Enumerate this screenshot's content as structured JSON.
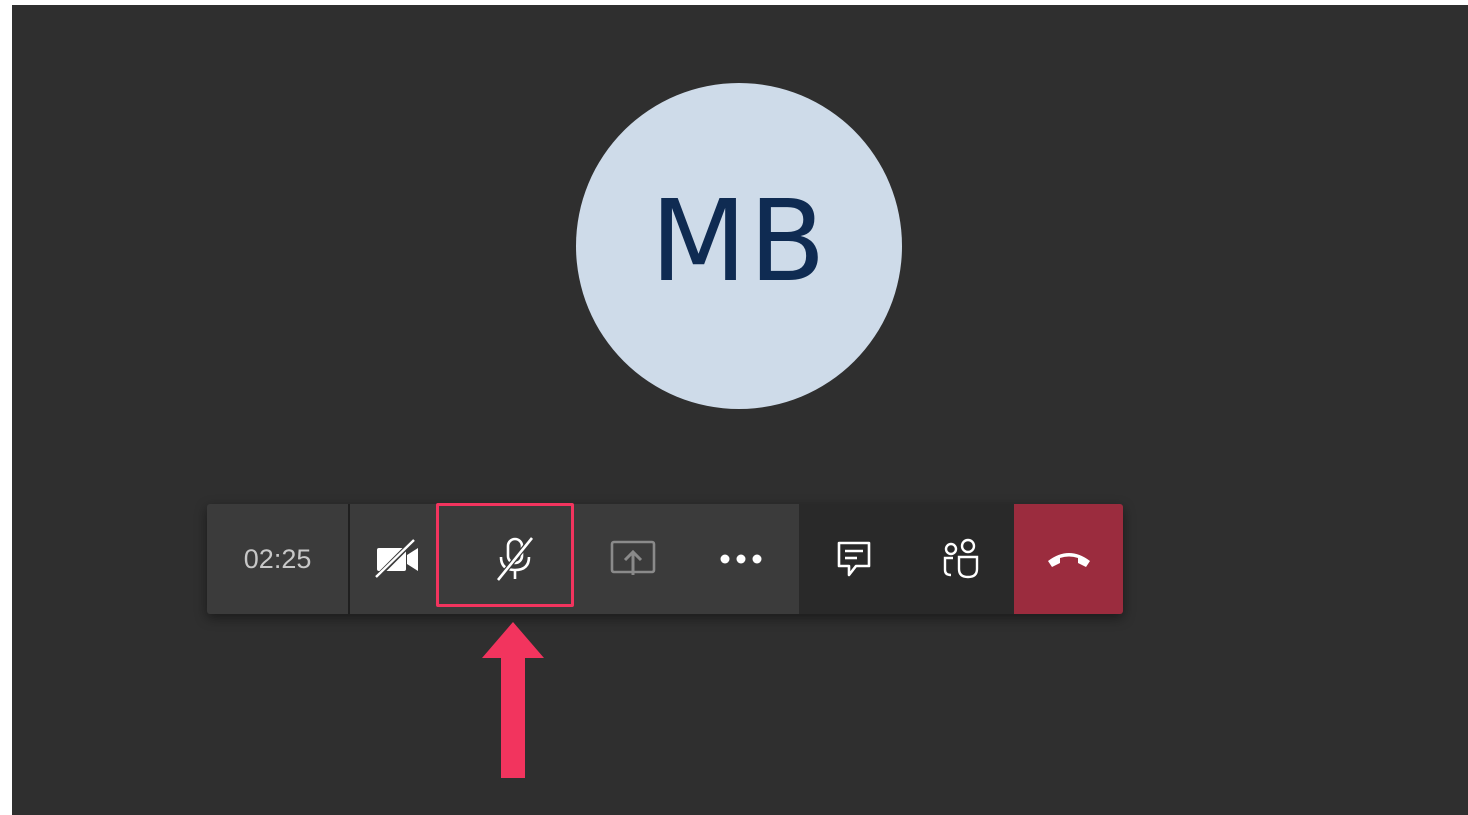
{
  "participant": {
    "initials": "MB"
  },
  "call_controls": {
    "timer": "02:25",
    "buttons": [
      {
        "name": "video-off",
        "icon": "video-off-icon",
        "state": "off"
      },
      {
        "name": "microphone-muted",
        "icon": "mic-off-icon",
        "state": "muted",
        "highlighted": true
      },
      {
        "name": "share-screen",
        "icon": "share-screen-icon",
        "state": "disabled"
      },
      {
        "name": "more-options",
        "icon": "more-icon"
      },
      {
        "name": "chat",
        "icon": "chat-icon"
      },
      {
        "name": "participants",
        "icon": "people-icon"
      },
      {
        "name": "hang-up",
        "icon": "phone-hangup-icon"
      }
    ]
  },
  "colors": {
    "stage_background": "#2f2f2f",
    "avatar_background": "#cedbe9",
    "avatar_text": "#0f2b52",
    "toolbar_background": "#3b3b3b",
    "toolbar_dark": "#292929",
    "hangup": "#9b2c3e",
    "annotation": "#f2345e"
  }
}
